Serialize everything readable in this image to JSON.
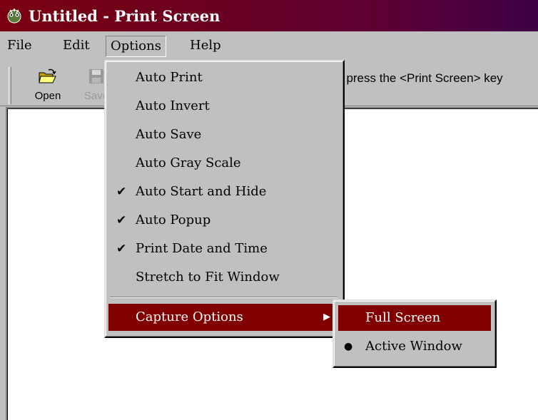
{
  "window": {
    "title": "Untitled - Print Screen",
    "icon": "print-screen-app-icon"
  },
  "menubar": {
    "items": [
      "File",
      "Edit",
      "Options",
      "Help"
    ],
    "active": "Options"
  },
  "toolbar": {
    "buttons": [
      {
        "label": "Open",
        "icon": "open-folder-icon",
        "enabled": true
      },
      {
        "label": "Save",
        "icon": "save-disk-icon",
        "enabled": false
      }
    ],
    "hint_text": "t press the <Print Screen> key"
  },
  "options_menu": {
    "items": [
      {
        "label": "Auto Print",
        "checked": false
      },
      {
        "label": "Auto Invert",
        "checked": false
      },
      {
        "label": "Auto Save",
        "checked": false
      },
      {
        "label": "Auto Gray Scale",
        "checked": false
      },
      {
        "label": "Auto Start and Hide",
        "checked": true,
        "check_glyph": "✔"
      },
      {
        "label": "Auto Popup",
        "checked": true,
        "check_glyph": "✔"
      },
      {
        "label": "Print Date and Time",
        "checked": true,
        "check_glyph": "✔"
      },
      {
        "label": "Stretch to Fit Window",
        "checked": false
      }
    ],
    "capture_options": {
      "label": "Capture Options",
      "arrow": "▶",
      "highlighted": true
    }
  },
  "capture_submenu": {
    "items": [
      {
        "label": "Full Screen",
        "selected": false,
        "highlighted": true
      },
      {
        "label": "Active Window",
        "selected": true,
        "bullet": "●"
      }
    ]
  },
  "colors": {
    "highlight": "#800000",
    "face": "#c0c0c0",
    "title_start": "#7a0010",
    "title_end": "#3c0044"
  }
}
